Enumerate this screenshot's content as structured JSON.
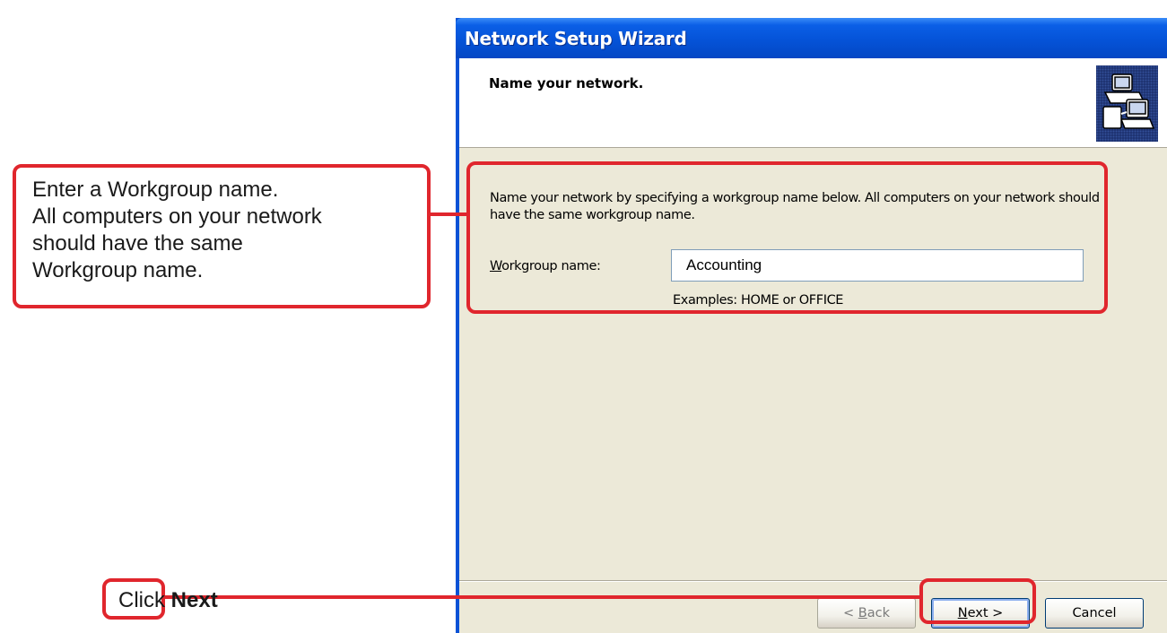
{
  "window": {
    "title": "Network Setup Wizard",
    "step_title": "Name your network.",
    "description": "Name your network by specifying a workgroup name below. All computers on your network should have the same workgroup name.",
    "workgroup_label_underlined": "W",
    "workgroup_label_rest": "orkgroup name:",
    "workgroup_value": "Accounting",
    "examples": "Examples: HOME or OFFICE",
    "buttons": {
      "back_prefix": "< ",
      "back_underlined": "B",
      "back_rest": "ack",
      "next_underlined": "N",
      "next_rest": "ext >",
      "cancel": "Cancel"
    }
  },
  "callouts": {
    "workgroup_lines": [
      "Enter a Workgroup name.",
      "All computers on your network",
      "should have the same",
      "Workgroup name."
    ],
    "next_prefix": "Click ",
    "next_bold": "Next"
  },
  "colors": {
    "titlebar": "#0553d8",
    "dialog_bg": "#ece9d8",
    "callout_red": "#e0262d"
  }
}
